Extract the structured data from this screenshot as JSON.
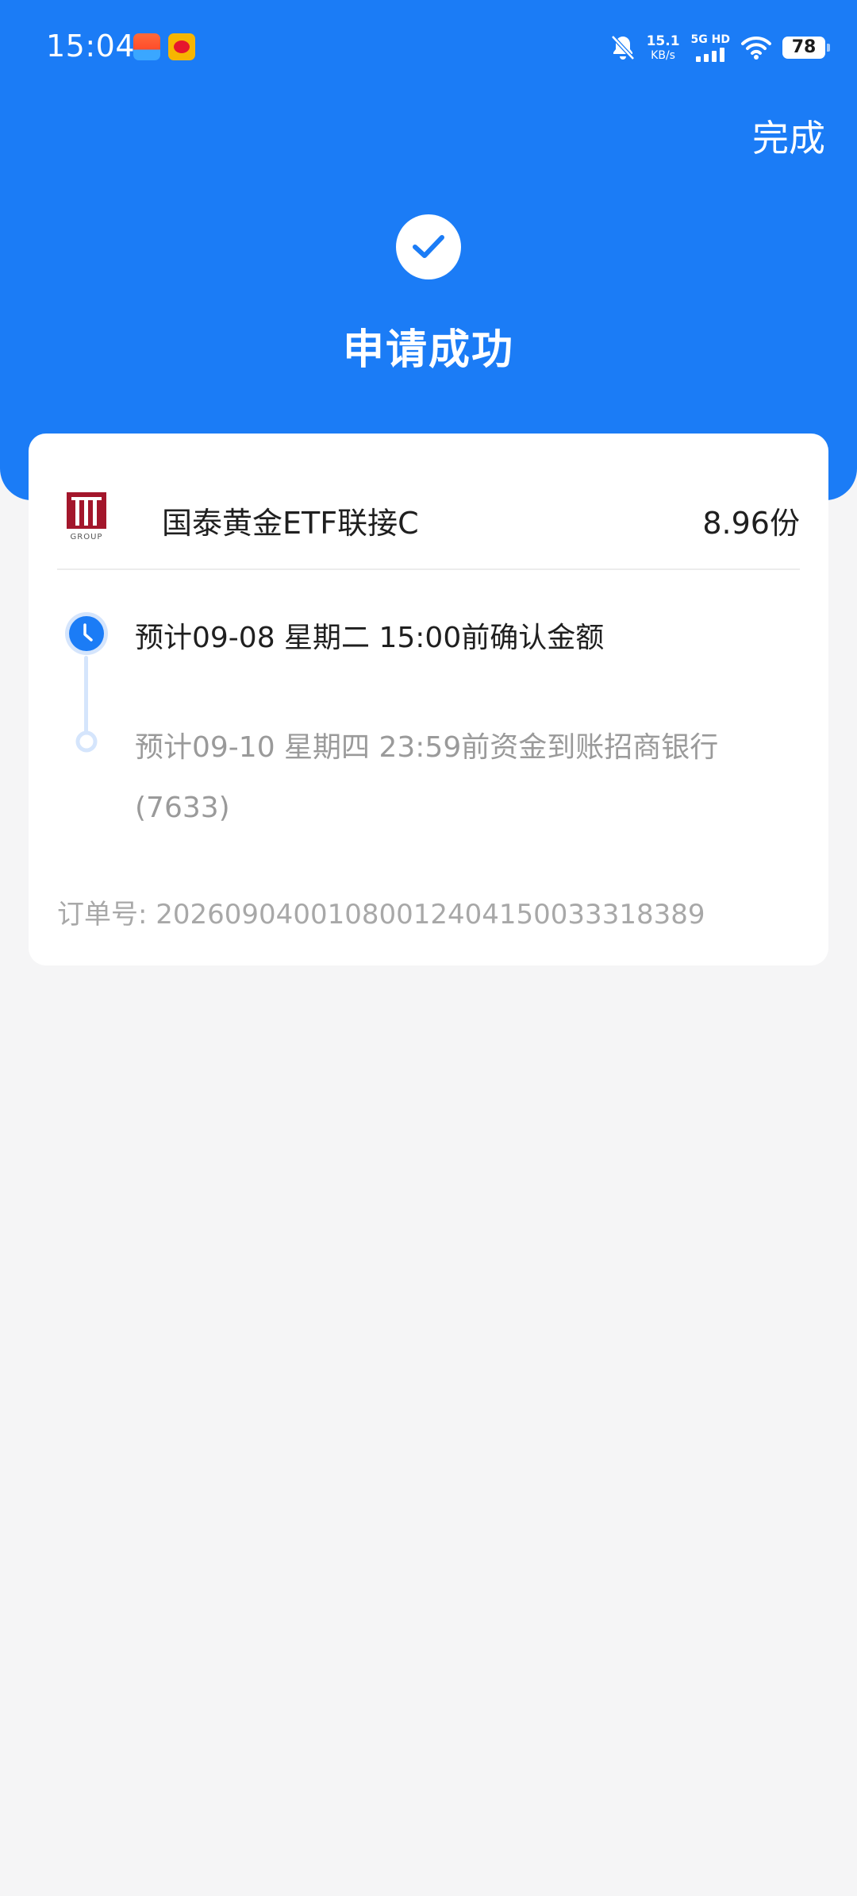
{
  "status_bar": {
    "time": "15:04",
    "net_speed_value": "15.1",
    "net_speed_unit": "KB/s",
    "network_label": "5G HD",
    "battery": "78"
  },
  "header": {
    "done_label": "完成",
    "title": "申请成功"
  },
  "fund": {
    "name": "国泰黄金ETF联接C",
    "shares": "8.96份",
    "logo_text": "GROUP"
  },
  "timeline": [
    {
      "text": "预计09-08 星期二 15:00前确认金额",
      "state": "active"
    },
    {
      "text": "预计09-10 星期四 23:59前资金到账招商银行(7633)",
      "state": "pending"
    }
  ],
  "order": {
    "label_and_number": "订单号: 20260904001080012404150033318389"
  },
  "colors": {
    "primary": "#1b7cf6",
    "background": "#f5f5f6",
    "text_primary": "#1f1f1f",
    "text_secondary": "#9a9a9a",
    "logo_red": "#a3162b"
  }
}
